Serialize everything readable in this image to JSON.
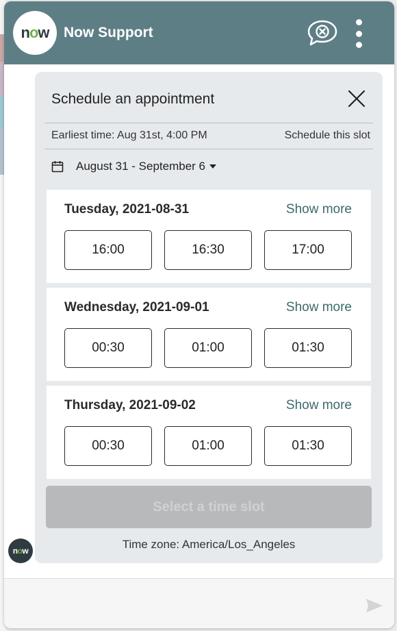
{
  "header": {
    "logo_text": "now",
    "title": "Now Support"
  },
  "card": {
    "title": "Schedule an appointment",
    "earliest": "Earliest time: Aug 31st, 4:00 PM",
    "schedule_link": "Schedule this slot",
    "date_range": "August 31 - September 6",
    "days": [
      {
        "name": "Tuesday, 2021-08-31",
        "show_more": "Show more",
        "slots": [
          "16:00",
          "16:30",
          "17:00"
        ]
      },
      {
        "name": "Wednesday, 2021-09-01",
        "show_more": "Show more",
        "slots": [
          "00:30",
          "01:00",
          "01:30"
        ]
      },
      {
        "name": "Thursday, 2021-09-02",
        "show_more": "Show more",
        "slots": [
          "00:30",
          "01:00",
          "01:30"
        ]
      }
    ],
    "select_button": "Select a time slot",
    "timezone": "Time zone: America/Los_Angeles"
  },
  "chat": {
    "avatar_text": "now"
  },
  "icons": {
    "end_chat": "end-chat-icon",
    "more": "more-vertical-icon",
    "close": "close-icon",
    "calendar": "calendar-icon",
    "caret": "caret-down-icon",
    "send": "send-icon"
  },
  "colors": {
    "header": "#5e7e86",
    "brand_green": "#6fb24a",
    "show_more": "#3b6a6e",
    "disabled_button": "#b7b9bb"
  }
}
